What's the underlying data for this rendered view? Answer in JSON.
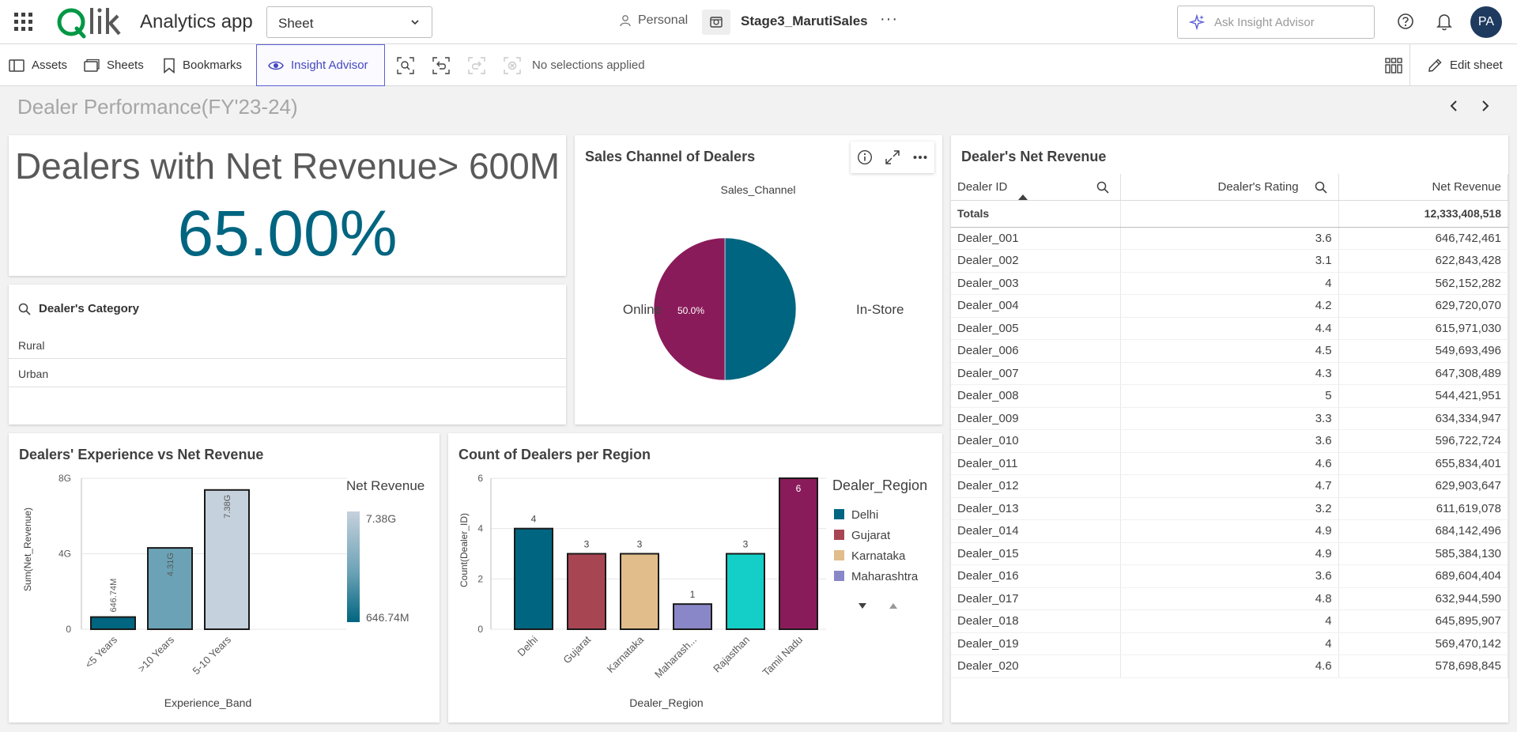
{
  "app": {
    "title": "Analytics app",
    "sheet_selector": "Sheet",
    "space": "Personal",
    "stage_title": "Stage3_MarutiSales",
    "more": "···",
    "ask_placeholder": "Ask Insight Advisor",
    "avatar": "PA"
  },
  "toolbar": {
    "assets": "Assets",
    "sheets": "Sheets",
    "bookmarks": "Bookmarks",
    "insight_advisor": "Insight Advisor",
    "no_selections": "No selections applied",
    "edit_sheet": "Edit sheet"
  },
  "sheet": {
    "title": "Dealer Performance(FY'23-24)"
  },
  "kpi": {
    "title": "Dealers with Net Revenue> 600M",
    "value": "65.00%"
  },
  "filter": {
    "title": "Dealer's Category",
    "items": [
      "Rural",
      "Urban"
    ]
  },
  "pie": {
    "panel_title": "Sales Channel of Dealers",
    "chart_data": {
      "type": "pie",
      "title": "Sales_Channel",
      "labels": [
        "In-Store",
        "Online"
      ],
      "values": [
        50.0,
        50.0
      ],
      "value_labels": [
        "50.0%",
        "50.0%"
      ],
      "colors": [
        "#006580",
        "#8a1b5a"
      ]
    }
  },
  "experience": {
    "panel_title": "Dealers' Experience vs Net Revenue",
    "chart_data": {
      "type": "bar",
      "categories": [
        "<5 Years",
        ">10 Years",
        "5-10 Years"
      ],
      "values": [
        646740000,
        4310000000,
        7380000000
      ],
      "value_labels": [
        "646.74M",
        "4.31G",
        "7.38G"
      ],
      "colors": [
        "#006580",
        "#6ba2b6",
        "#c5d1dc"
      ],
      "xlabel": "Experience_Band",
      "ylabel": "Sum(Net_Revenue)",
      "ylim": [
        0,
        8000000000
      ],
      "yticks": [
        "0",
        "4G",
        "8G"
      ],
      "legend_title": "Net Revenue",
      "legend_max": "7.38G",
      "legend_min": "646.74M",
      "grid": true
    }
  },
  "region": {
    "panel_title": "Count of Dealers per Region",
    "chart_data": {
      "type": "bar",
      "categories": [
        "Delhi",
        "Gujarat",
        "Karnataka",
        "Maharash...",
        "Rajasthan",
        "Tamil Nadu"
      ],
      "values": [
        4,
        3,
        3,
        1,
        3,
        6
      ],
      "colors": [
        "#006580",
        "#a84553",
        "#e0bd8a",
        "#8a87c8",
        "#13cfc7",
        "#8a1b5a"
      ],
      "xlabel": "Dealer_Region",
      "ylabel": "Count(Dealer_ID)",
      "ylim": [
        0,
        6
      ],
      "yticks": [
        "0",
        "2",
        "4",
        "6"
      ],
      "legend_title": "Dealer_Region",
      "legend_items": [
        "Delhi",
        "Gujarat",
        "Karnataka",
        "Maharashtra"
      ],
      "grid": true
    }
  },
  "revenue_table": {
    "panel_title": "Dealer's Net Revenue",
    "columns": [
      "Dealer ID",
      "Dealer's Rating",
      "Net Revenue"
    ],
    "totals_label": "Totals",
    "totals_value": "12,333,408,518",
    "rows": [
      [
        "Dealer_001",
        "3.6",
        "646,742,461"
      ],
      [
        "Dealer_002",
        "3.1",
        "622,843,428"
      ],
      [
        "Dealer_003",
        "4",
        "562,152,282"
      ],
      [
        "Dealer_004",
        "4.2",
        "629,720,070"
      ],
      [
        "Dealer_005",
        "4.4",
        "615,971,030"
      ],
      [
        "Dealer_006",
        "4.5",
        "549,693,496"
      ],
      [
        "Dealer_007",
        "4.3",
        "647,308,489"
      ],
      [
        "Dealer_008",
        "5",
        "544,421,951"
      ],
      [
        "Dealer_009",
        "3.3",
        "634,334,947"
      ],
      [
        "Dealer_010",
        "3.6",
        "596,722,724"
      ],
      [
        "Dealer_011",
        "4.6",
        "655,834,401"
      ],
      [
        "Dealer_012",
        "4.7",
        "629,903,647"
      ],
      [
        "Dealer_013",
        "3.2",
        "611,619,078"
      ],
      [
        "Dealer_014",
        "4.9",
        "684,142,496"
      ],
      [
        "Dealer_015",
        "4.9",
        "585,384,130"
      ],
      [
        "Dealer_016",
        "3.6",
        "689,604,404"
      ],
      [
        "Dealer_017",
        "4.8",
        "632,944,590"
      ],
      [
        "Dealer_018",
        "4",
        "645,895,907"
      ],
      [
        "Dealer_019",
        "4",
        "569,470,142"
      ],
      [
        "Dealer_020",
        "4.6",
        "578,698,845"
      ]
    ]
  }
}
